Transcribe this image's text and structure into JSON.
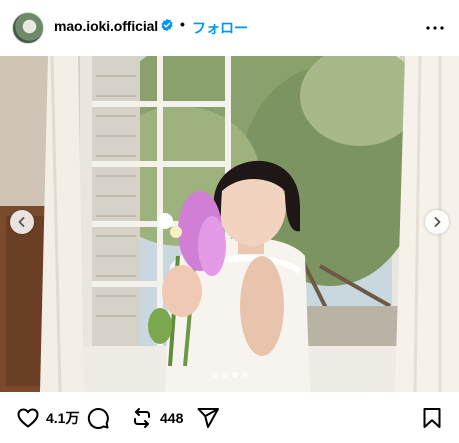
{
  "header": {
    "username": "mao.ioki.official",
    "separator": "•",
    "follow_label": "フォロー",
    "verified_icon": "verified-badge-icon",
    "more_icon": "more-options-icon"
  },
  "post": {
    "carousel": {
      "slide_count": 4,
      "active_index": 2,
      "prev_icon": "chevron-left-icon",
      "next_icon": "chevron-right-icon"
    }
  },
  "actions": {
    "like_count": "4.1万",
    "repost_count": "448",
    "icons": [
      "heart-icon",
      "comment-icon",
      "repost-icon",
      "share-icon",
      "bookmark-icon"
    ]
  },
  "colors": {
    "accent": "#0095f6",
    "verified": "#0095f6",
    "text": "#000000"
  }
}
